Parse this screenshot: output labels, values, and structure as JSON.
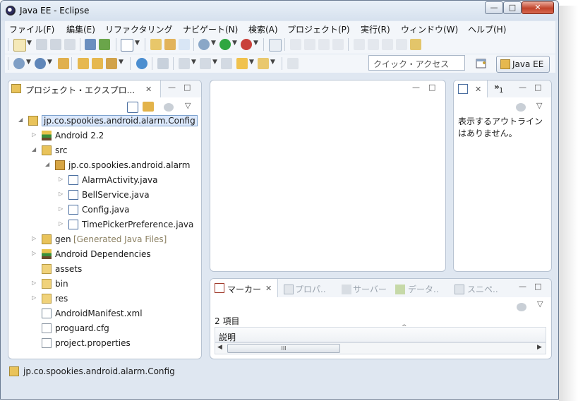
{
  "window": {
    "title": "Java EE - Eclipse",
    "minimize": "—",
    "maximize": "□",
    "close": "✕"
  },
  "menubar": [
    "ファイル(F)",
    "編集(E)",
    "リファクタリング",
    "ナビゲート(N)",
    "検索(A)",
    "プロジェクト(P)",
    "実行(R)",
    "ウィンドウ(W)",
    "ヘルプ(H)"
  ],
  "toolbar": {
    "quick_access_placeholder": "クイック・アクセス",
    "perspective_label": "Java EE"
  },
  "explorer": {
    "tab_label": "プロジェクト・エクスプロ...",
    "tree": [
      {
        "label": "jp.co.spookies.android.alarm.Config",
        "level": 0,
        "icon": "project-folder-icon",
        "twisty": "◢",
        "selected": true
      },
      {
        "label": "Android 2.2",
        "level": 1,
        "icon": "library-icon",
        "twisty": "▷"
      },
      {
        "label": "src",
        "level": 1,
        "icon": "source-folder-icon",
        "twisty": "◢"
      },
      {
        "label": "jp.co.spookies.android.alarm",
        "level": 2,
        "icon": "package-icon",
        "twisty": "◢"
      },
      {
        "label": "AlarmActivity.java",
        "level": 3,
        "icon": "java-file-icon",
        "twisty": "▷"
      },
      {
        "label": "BellService.java",
        "level": 3,
        "icon": "java-file-icon",
        "twisty": "▷"
      },
      {
        "label": "Config.java",
        "level": 3,
        "icon": "java-file-icon",
        "twisty": "▷"
      },
      {
        "label": "TimePickerPreference.java",
        "level": 3,
        "icon": "java-file-icon",
        "twisty": "▷"
      },
      {
        "label": "gen",
        "suffix": "[Generated Java Files]",
        "level": 1,
        "icon": "source-folder-icon",
        "twisty": "▷"
      },
      {
        "label": "Android Dependencies",
        "level": 1,
        "icon": "library-icon",
        "twisty": "▷"
      },
      {
        "label": "assets",
        "level": 1,
        "icon": "folder-icon",
        "twisty": ""
      },
      {
        "label": "bin",
        "level": 1,
        "icon": "folder-icon",
        "twisty": "▷"
      },
      {
        "label": "res",
        "level": 1,
        "icon": "folder-icon",
        "twisty": "▷"
      },
      {
        "label": "AndroidManifest.xml",
        "level": 1,
        "icon": "xml-file-icon",
        "twisty": ""
      },
      {
        "label": "proguard.cfg",
        "level": 1,
        "icon": "text-file-icon",
        "twisty": ""
      },
      {
        "label": "project.properties",
        "level": 1,
        "icon": "text-file-icon",
        "twisty": ""
      }
    ]
  },
  "outline": {
    "overflow_label": "»",
    "overflow_count": "1",
    "message": "表示するアウトライン\nはありません。"
  },
  "bottom": {
    "tabs": [
      {
        "label": "マーカー",
        "active": true
      },
      {
        "label": "プロパ..",
        "active": false
      },
      {
        "label": "サーバー",
        "active": false
      },
      {
        "label": "データ..",
        "active": false
      },
      {
        "label": "スニペ..",
        "active": false
      }
    ],
    "item_count": "2 項目",
    "column_header": "説明",
    "scroll_grip": "III"
  },
  "status": {
    "text": "jp.co.spookies.android.alarm.Config"
  },
  "colors": {
    "accent": "#3a74c4",
    "frame": "#dfe7f1",
    "panel_border": "#b7c3d2",
    "selection": "#dbe8fb"
  }
}
